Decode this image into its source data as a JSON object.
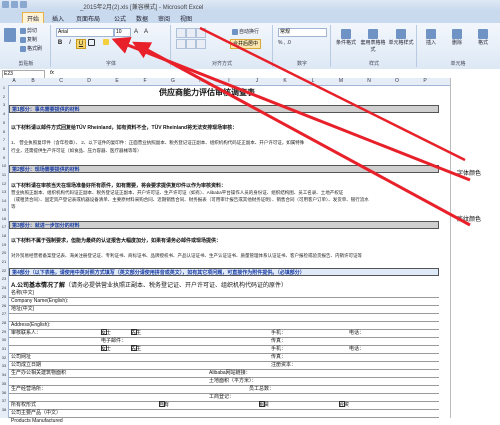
{
  "window": {
    "title": "_2015年2月(2).xls [兼容模式] - Microsoft Excel",
    "tabs": [
      "开始",
      "插入",
      "页面布局",
      "公式",
      "数据",
      "审阅",
      "视图"
    ]
  },
  "ribbon": {
    "clipboard": {
      "cut": "剪切",
      "copy": "复制",
      "format_painter": "格式刷",
      "group_label": "剪贴板"
    },
    "font": {
      "font_name": "Arial",
      "font_size": "10",
      "bold": "B",
      "italic": "I",
      "underline": "U",
      "group_label": "字体"
    },
    "alignment": {
      "wrap": "自动换行",
      "merge": "合并后居中",
      "group_label": "对齐方式"
    },
    "number": {
      "format": "常规",
      "group_label": "数字"
    },
    "styles": {
      "conditional": "条件格式",
      "table": "套用表格格式",
      "cell_styles": "单元格样式",
      "group_label": "样式"
    },
    "cells": {
      "insert": "插入",
      "delete": "删除",
      "format": "格式",
      "group_label": "单元格"
    }
  },
  "formula_bar": {
    "name_box": "E23",
    "fx": "fx"
  },
  "columns": [
    "A",
    "B",
    "C",
    "D",
    "E",
    "F",
    "G",
    "H",
    "I",
    "J",
    "K",
    "L",
    "M",
    "N",
    "O",
    "P"
  ],
  "rows": [
    "1",
    "2",
    "3",
    "4",
    "5",
    "6",
    "7",
    "8",
    "9",
    "10",
    "11",
    "12",
    "13",
    "14",
    "15",
    "16",
    "17",
    "18",
    "19",
    "20",
    "21",
    "22",
    "23",
    "24",
    "25",
    "26",
    "27",
    "28",
    "29",
    "30",
    "31",
    "32",
    "33",
    "34",
    "35",
    "36",
    "37",
    "38"
  ],
  "sheet": {
    "title": "供应商能力评估审核调查表",
    "section1": "第1部分：事先需要提供的材料",
    "section1_note": "以下材料请以邮件方式回复给TÜV Rheinland，如有资料不全，TÜV Rheinland将无法安排现场审核：",
    "section1_text1": "1、 营业执照复印件（含年检章）、 2、以下证件的复印件：正面营业执照副本、税务登记证正副本、组织机构代码证正副本、开户许可证，如属特殊",
    "section1_text2": "行业，还需提供生产许可证（如食品、压力容器、医疗器械等等）",
    "section2": "第2部分：现场需要提供的材料",
    "section2_note": "以下材料请在审核当天在现场准备好所有原件，如有需要，将会要求提供复印件以作为审核资料：",
    "section2_text1": "营业执照正副本、组织机构代码证正副本、税务登记证正副本、开户许可证、生产许可证（如有）、Alibaba平台操作人员的身份证、组织结构图、员工名录、土地产权证",
    "section2_text2": "（或租赁合同）、固定资产登记表或机器设备清单、主要原材料采购合同、近期销售合同、财务报表（可用审计报告或其他财务证明）、销售合同（可用客户订单）、发货单、银行流水",
    "section2_text3": "等",
    "section3": "第3部分：就进一步加分的材料",
    "section3_note": "以下材料不属于强制要求，但能为最终的认证报告大幅度加分，如果有请务必邮件或现场提供：",
    "section3_text1": "对外贸易经营者备案登记表、海关注册登记证、专利证书、商标证书、品牌授权书、产品认证证书、生产认证证书、质量管理体系认证证书、客户报检或验货报告、内销许可证等",
    "section4": "第4部分（以下表格，请使用中英对照方式填写（英文部分请使用拼音或英文），如有其它项问题，可直接作为附件提供。（必填部分）",
    "sectionA": "A.公司基本情况了解",
    "sectionA_note": "（请务必提供营业执照正副本、税务登记证、开户许可证、组织机构代码证的原件）",
    "form_labels": [
      "名称(中文)",
      "Company Name(English):",
      "地址(中文)",
      "",
      "Address(English):",
      "审核联系人：",
      "",
      "公司网址",
      "公司成立日期",
      "生产办公相关建筑物面积",
      "生产经营场所：",
      "所有权形式",
      "公司主要产品（中文）",
      "Products Manufactured"
    ],
    "form_extra": {
      "female": "女士",
      "male": "先生",
      "mobile": "手机：",
      "phone": "电话：",
      "email": "电子邮件：",
      "fax": "传真：",
      "reg_capital": "注册资本：",
      "alibaba": "Alibaba网站链接：",
      "land": "土地面积（平方米）：",
      "staff": "员工总数：",
      "own": "自有",
      "rent": "租赁",
      "other": "合资",
      "reg_dept": "工商登记：",
      "reg_no": "营业执照号："
    }
  },
  "sidebar": {
    "font_color": "字体颜色",
    "border": "底纹颜色"
  },
  "colors": {
    "arrow": "#e8202a",
    "section_gray": "#cfcfcf",
    "ribbon_bg": "#dde8f5"
  }
}
